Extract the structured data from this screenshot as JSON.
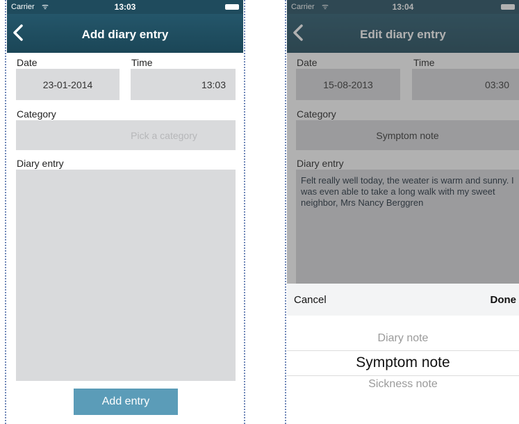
{
  "left": {
    "status": {
      "carrier": "Carrier",
      "time": "13:03"
    },
    "nav": {
      "title": "Add diary entry"
    },
    "date_label": "Date",
    "date_value": "23-01-2014",
    "time_label": "Time",
    "time_value": "13:03",
    "category_label": "Category",
    "category_placeholder": "Pick a category",
    "entry_label": "Diary entry",
    "entry_value": "",
    "add_button": "Add entry"
  },
  "right": {
    "status": {
      "carrier": "Carrier",
      "time": "13:04"
    },
    "nav": {
      "title": "Edit diary entry"
    },
    "date_label": "Date",
    "date_value": "15-08-2013",
    "time_label": "Time",
    "time_value": "03:30",
    "category_label": "Category",
    "category_value": "Symptom note",
    "entry_label": "Diary entry",
    "entry_value": "Felt really well today, the weater is warm and sunny. I was even able to take a long walk with my sweet neighbor, Mrs Nancy Berggren",
    "picker": {
      "cancel": "Cancel",
      "done": "Done",
      "options": [
        "Diary note",
        "Symptom note",
        "Sickness note"
      ],
      "selected_index": 1
    }
  },
  "colors": {
    "navbar": "#1f4b5d",
    "field": "#d9dadc",
    "button": "#5b9cb8"
  }
}
